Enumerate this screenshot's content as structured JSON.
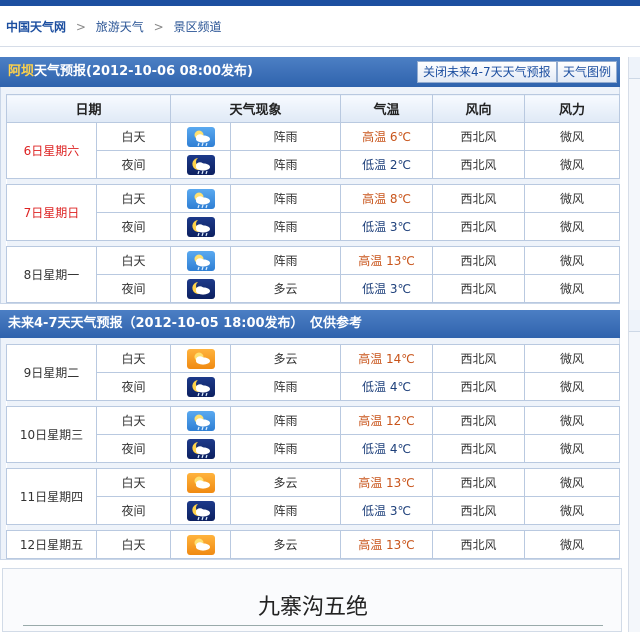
{
  "breadcrumb": {
    "site": "中国天气网",
    "sep": ">",
    "items": [
      "旅游天气",
      "景区频道"
    ]
  },
  "forecast_now": {
    "city": "阿坝",
    "title_rest": "天气预报(2012-10-06  08:00发布)",
    "buttons": {
      "close_future": "关闭未来4-7天天气预报",
      "legend": "天气图例"
    },
    "columns": [
      "日期",
      "天气现象",
      "气温",
      "风向",
      "风力"
    ],
    "days": [
      {
        "date": "6日星期六",
        "highlight": true,
        "rows": [
          {
            "period": "白天",
            "icon": "shower-day-icon",
            "phenomenon": "阵雨",
            "temp": "高温 6℃",
            "kind": "hi",
            "wind_dir": "西北风",
            "wind_force": "微风"
          },
          {
            "period": "夜间",
            "icon": "shower-night-icon",
            "phenomenon": "阵雨",
            "temp": "低温 2℃",
            "kind": "lo",
            "wind_dir": "西北风",
            "wind_force": "微风"
          }
        ]
      },
      {
        "date": "7日星期日",
        "highlight": true,
        "rows": [
          {
            "period": "白天",
            "icon": "shower-day-icon",
            "phenomenon": "阵雨",
            "temp": "高温 8℃",
            "kind": "hi",
            "wind_dir": "西北风",
            "wind_force": "微风"
          },
          {
            "period": "夜间",
            "icon": "shower-night-icon",
            "phenomenon": "阵雨",
            "temp": "低温 3℃",
            "kind": "lo",
            "wind_dir": "西北风",
            "wind_force": "微风"
          }
        ]
      },
      {
        "date": "8日星期一",
        "highlight": false,
        "rows": [
          {
            "period": "白天",
            "icon": "shower-day-icon",
            "phenomenon": "阵雨",
            "temp": "高温 13℃",
            "kind": "hi",
            "wind_dir": "西北风",
            "wind_force": "微风"
          },
          {
            "period": "夜间",
            "icon": "cloudy-night-icon",
            "phenomenon": "多云",
            "temp": "低温 3℃",
            "kind": "lo",
            "wind_dir": "西北风",
            "wind_force": "微风"
          }
        ]
      }
    ]
  },
  "forecast_future": {
    "title": "未来4-7天天气预报（2012-10-05 18:00发布）　仅供参考",
    "days": [
      {
        "date": "9日星期二",
        "rows": [
          {
            "period": "白天",
            "icon": "cloudy-day-icon",
            "phenomenon": "多云",
            "temp": "高温 14℃",
            "kind": "hi",
            "wind_dir": "西北风",
            "wind_force": "微风"
          },
          {
            "period": "夜间",
            "icon": "shower-night-icon",
            "phenomenon": "阵雨",
            "temp": "低温 4℃",
            "kind": "lo",
            "wind_dir": "西北风",
            "wind_force": "微风"
          }
        ]
      },
      {
        "date": "10日星期三",
        "rows": [
          {
            "period": "白天",
            "icon": "shower-day-icon",
            "phenomenon": "阵雨",
            "temp": "高温 12℃",
            "kind": "hi",
            "wind_dir": "西北风",
            "wind_force": "微风"
          },
          {
            "period": "夜间",
            "icon": "shower-night-icon",
            "phenomenon": "阵雨",
            "temp": "低温 4℃",
            "kind": "lo",
            "wind_dir": "西北风",
            "wind_force": "微风"
          }
        ]
      },
      {
        "date": "11日星期四",
        "rows": [
          {
            "period": "白天",
            "icon": "cloudy-day-icon",
            "phenomenon": "多云",
            "temp": "高温 13℃",
            "kind": "hi",
            "wind_dir": "西北风",
            "wind_force": "微风"
          },
          {
            "period": "夜间",
            "icon": "shower-night-icon",
            "phenomenon": "阵雨",
            "temp": "低温 3℃",
            "kind": "lo",
            "wind_dir": "西北风",
            "wind_force": "微风"
          }
        ]
      },
      {
        "date": "12日星期五",
        "rows": [
          {
            "period": "白天",
            "icon": "cloudy-day-icon",
            "phenomenon": "多云",
            "temp": "高温 13℃",
            "kind": "hi",
            "wind_dir": "西北风",
            "wind_force": "微风"
          }
        ]
      }
    ]
  },
  "bottom": {
    "title": "九寨沟五绝"
  },
  "colors": {
    "brand_blue": "#1d4fa0",
    "header_gradient_top": "#4c7fc4",
    "date_red": "#dd2222",
    "temp_high": "#c8541a",
    "temp_low": "#1d3f7a"
  }
}
